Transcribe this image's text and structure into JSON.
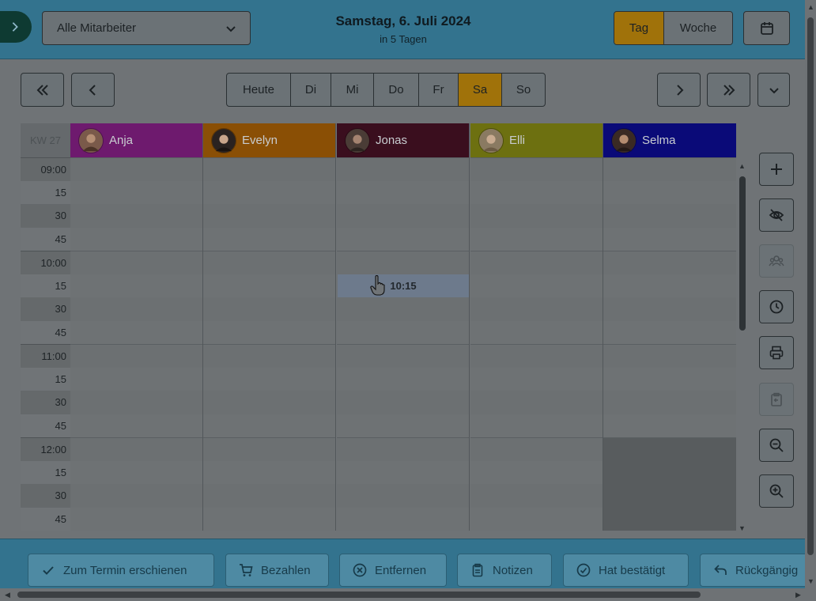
{
  "header": {
    "staff_select": "Alle Mitarbeiter",
    "date_title": "Samstag, 6. Juli 2024",
    "date_sub": "in 5 Tagen",
    "view_day": "Tag",
    "view_week": "Woche"
  },
  "nav": {
    "days": [
      "Heute",
      "Di",
      "Mi",
      "Do",
      "Fr",
      "Sa",
      "So"
    ],
    "active_day": "Sa"
  },
  "calendar": {
    "week_label": "KW 27",
    "staff": [
      {
        "name": "Anja",
        "color": "#6e1a6e"
      },
      {
        "name": "Evelyn",
        "color": "#8a4f05"
      },
      {
        "name": "Jonas",
        "color": "#3a0e1e"
      },
      {
        "name": "Elli",
        "color": "#6d7010"
      },
      {
        "name": "Selma",
        "color": "#0a0a78"
      }
    ],
    "times": [
      "09:00",
      "15",
      "30",
      "45",
      "10:00",
      "15",
      "30",
      "45",
      "11:00",
      "15",
      "30",
      "45",
      "12:00",
      "15",
      "30",
      "45"
    ],
    "hover_slot_label": "10:15"
  },
  "colors": {
    "header_bg": "#33738e",
    "accent_active": "#a0720a",
    "footer_bg": "#33738e"
  },
  "footer": {
    "appeared": "Zum Termin erschienen",
    "pay": "Bezahlen",
    "remove": "Entfernen",
    "notes": "Notizen",
    "confirmed": "Hat bestätigt",
    "undo": "Rückgängig"
  }
}
